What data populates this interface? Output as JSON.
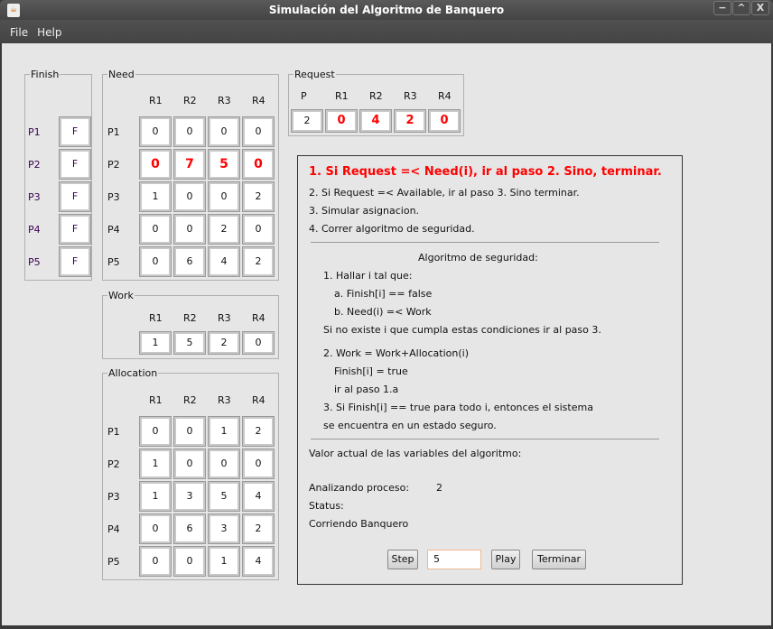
{
  "window": {
    "title": "Simulación del Algoritmo de Banquero",
    "controls": [
      "−",
      "^",
      "X"
    ]
  },
  "menu": [
    "File",
    "Help"
  ],
  "resources": [
    "R1",
    "R2",
    "R3",
    "R4"
  ],
  "processes": [
    "P1",
    "P2",
    "P3",
    "P4",
    "P5"
  ],
  "finish": {
    "title": "Finish",
    "values": [
      "F",
      "F",
      "F",
      "F",
      "F"
    ]
  },
  "need": {
    "title": "Need",
    "highlight_row": 1,
    "values": [
      [
        "0",
        "0",
        "0",
        "0"
      ],
      [
        "0",
        "7",
        "5",
        "0"
      ],
      [
        "1",
        "0",
        "0",
        "2"
      ],
      [
        "0",
        "0",
        "2",
        "0"
      ],
      [
        "0",
        "6",
        "4",
        "2"
      ]
    ]
  },
  "work": {
    "title": "Work",
    "values": [
      "1",
      "5",
      "2",
      "0"
    ]
  },
  "allocation": {
    "title": "Allocation",
    "values": [
      [
        "0",
        "0",
        "1",
        "2"
      ],
      [
        "1",
        "0",
        "0",
        "0"
      ],
      [
        "1",
        "3",
        "5",
        "4"
      ],
      [
        "0",
        "6",
        "3",
        "2"
      ],
      [
        "0",
        "0",
        "1",
        "4"
      ]
    ]
  },
  "request": {
    "title": "Request",
    "p_label": "P",
    "p_value": "2",
    "values": [
      "0",
      "4",
      "2",
      "0"
    ]
  },
  "steps": [
    "1. Si Request =< Need(i), ir al paso 2. Sino, terminar.",
    "2. Si Request =< Available, ir al paso 3. Sino terminar.",
    "3. Simular asignacion.",
    "4. Correr algoritmo de seguridad."
  ],
  "safety": {
    "title": "Algoritmo de seguridad:",
    "lines": [
      "1. Hallar i tal que:",
      "a. Finish[i] == false",
      "b. Need(i) =<  Work",
      "Si no existe i que cumpla estas condiciones ir al paso 3.",
      "2. Work = Work+Allocation(i)",
      "Finish[i] =  true",
      "ir al paso 1.a",
      "3. Si Finish[i] == true para todo i, entonces el sistema",
      "se encuentra en un estado seguro."
    ]
  },
  "state": {
    "heading": "Valor actual de las variables del algoritmo:",
    "process_label": "Analizando proceso:",
    "process_value": "2",
    "status_label": "Status:",
    "status_value": "Corriendo Banquero"
  },
  "controls": {
    "step": "Step",
    "input_value": "5",
    "play": "Play",
    "terminate": "Terminar"
  }
}
